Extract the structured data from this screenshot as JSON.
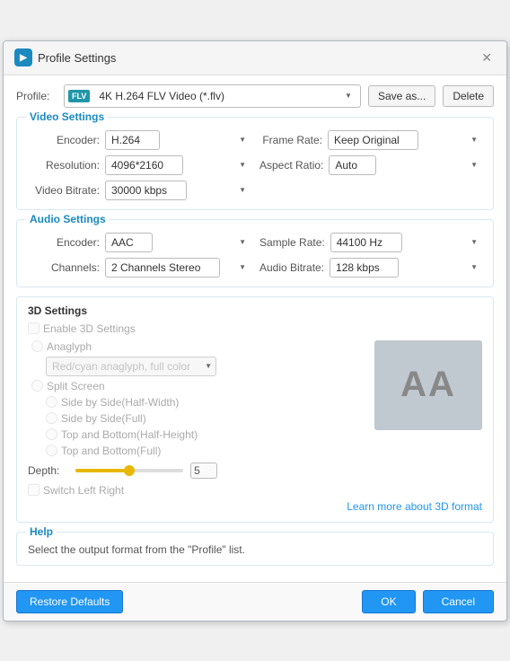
{
  "titleBar": {
    "title": "Profile Settings",
    "appIconText": "▶",
    "closeLabel": "✕"
  },
  "profile": {
    "label": "Profile:",
    "formatIconText": "FLV",
    "selectedProfile": "4K H.264 FLV Video (*.flv)",
    "saveAsLabel": "Save as...",
    "deleteLabel": "Delete"
  },
  "videoSettings": {
    "sectionTitle": "Video Settings",
    "encoderLabel": "Encoder:",
    "encoderValue": "H.264",
    "resolutionLabel": "Resolution:",
    "resolutionValue": "4096*2160",
    "videoBitrateLabel": "Video Bitrate:",
    "videoBitrateValue": "30000 kbps",
    "frameRateLabel": "Frame Rate:",
    "frameRateValue": "Keep Original",
    "aspectRatioLabel": "Aspect Ratio:",
    "aspectRatioValue": "Auto"
  },
  "audioSettings": {
    "sectionTitle": "Audio Settings",
    "encoderLabel": "Encoder:",
    "encoderValue": "AAC",
    "channelsLabel": "Channels:",
    "channelsValue": "2 Channels Stereo",
    "sampleRateLabel": "Sample Rate:",
    "sampleRateValue": "44100 Hz",
    "audioBitrateLabel": "Audio Bitrate:",
    "audioBitrateValue": "128 kbps"
  },
  "threeDSettings": {
    "sectionTitle": "3D Settings",
    "enableLabel": "Enable 3D Settings",
    "anaglyph": "Anaglyph",
    "anaglyphOption": "Red/cyan anaglyph, full color",
    "splitScreen": "Split Screen",
    "options": [
      "Side by Side(Half-Width)",
      "Side by Side(Full)",
      "Top and Bottom(Half-Height)",
      "Top and Bottom(Full)"
    ],
    "depthLabel": "Depth:",
    "depthValue": "5",
    "switchLabel": "Switch Left Right",
    "learnMoreText": "Learn more about 3D format",
    "previewText": "AA"
  },
  "help": {
    "sectionTitle": "Help",
    "helpText": "Select the output format from the \"Profile\" list."
  },
  "footer": {
    "restoreDefaultsLabel": "Restore Defaults",
    "okLabel": "OK",
    "cancelLabel": "Cancel"
  }
}
